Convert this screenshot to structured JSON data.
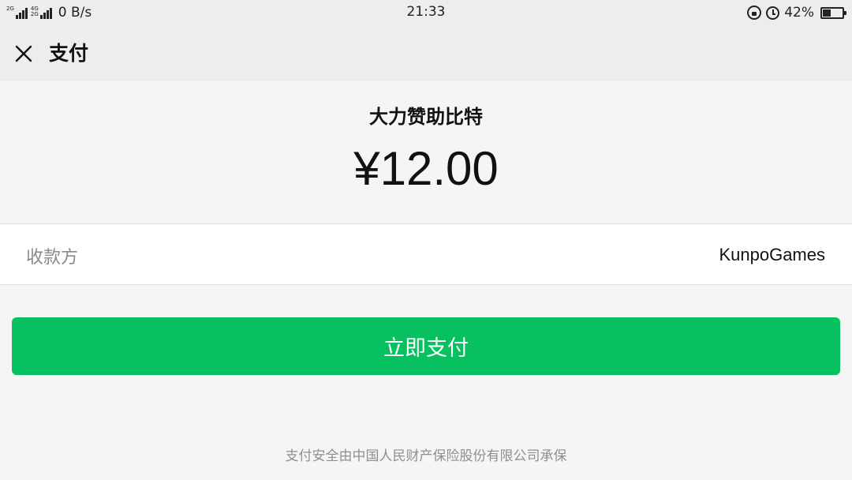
{
  "status_bar": {
    "network_1": "2G",
    "network_2": "4G",
    "network_3": "2G",
    "speed": "0 B/s",
    "time": "21:33",
    "battery_percent": "42%",
    "battery_level": 0.42
  },
  "header": {
    "title": "支付",
    "close_icon": "close-icon"
  },
  "order": {
    "product_name": "大力赞助比特",
    "amount": "¥12.00"
  },
  "payee": {
    "label": "收款方",
    "value": "KunpoGames"
  },
  "actions": {
    "pay_now_label": "立即支付"
  },
  "footer": {
    "insurance_note": "支付安全由中国人民财产保险股份有限公司承保"
  },
  "colors": {
    "accent_green": "#07c160",
    "header_bg": "#ededed",
    "page_bg": "#f5f5f5"
  }
}
